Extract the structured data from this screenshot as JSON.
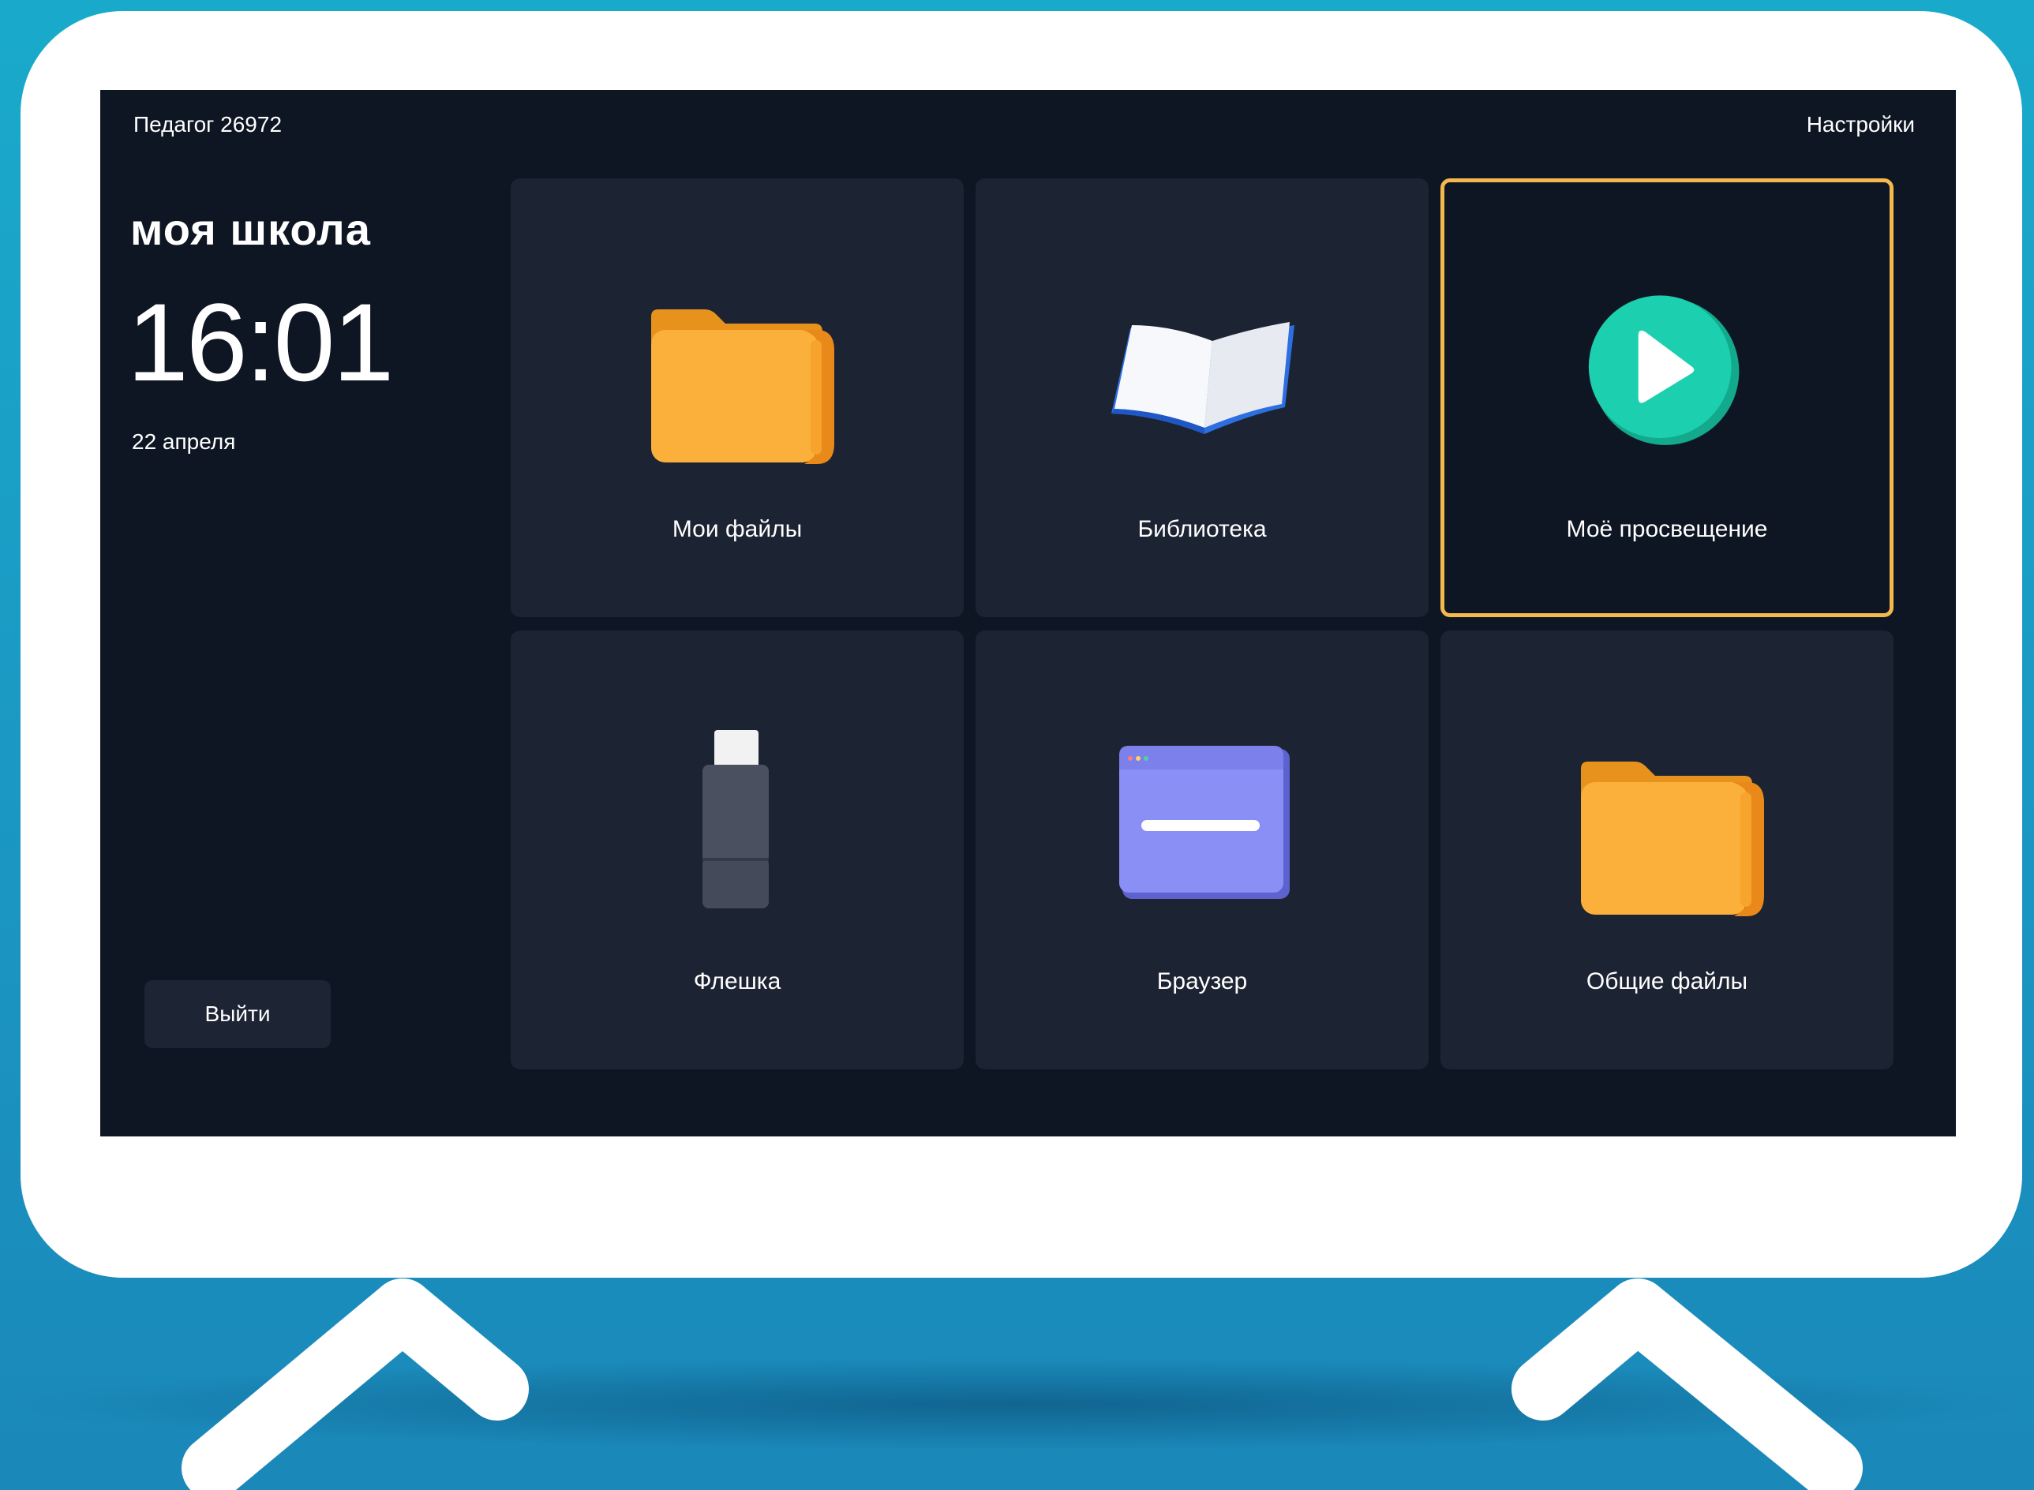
{
  "header": {
    "user_name": "Педагог 26972",
    "settings_label": "Настройки"
  },
  "sidebar": {
    "school_title": "моя школа",
    "time": "16:01",
    "date": "22 апреля",
    "logout_label": "Выйти"
  },
  "tiles": [
    {
      "label": "Мои файлы",
      "icon": "folder-icon",
      "selected": false
    },
    {
      "label": "Библиотека",
      "icon": "book-icon",
      "selected": false
    },
    {
      "label": "Моё просвещение",
      "icon": "play-icon",
      "selected": true
    },
    {
      "label": "Флешка",
      "icon": "usb-drive-icon",
      "selected": false
    },
    {
      "label": "Браузер",
      "icon": "browser-window-icon",
      "selected": false
    },
    {
      "label": "Общие файлы",
      "icon": "folder-icon",
      "selected": false
    }
  ],
  "colors": {
    "background": "#1a9fc8",
    "tv_frame": "#ffffff",
    "screen": "#0e1624",
    "tile": "#1c2332",
    "selection_border": "#f3b94c",
    "folder": "#fbb03b",
    "play": "#1ccfae",
    "browser": "#8a8ff5"
  }
}
